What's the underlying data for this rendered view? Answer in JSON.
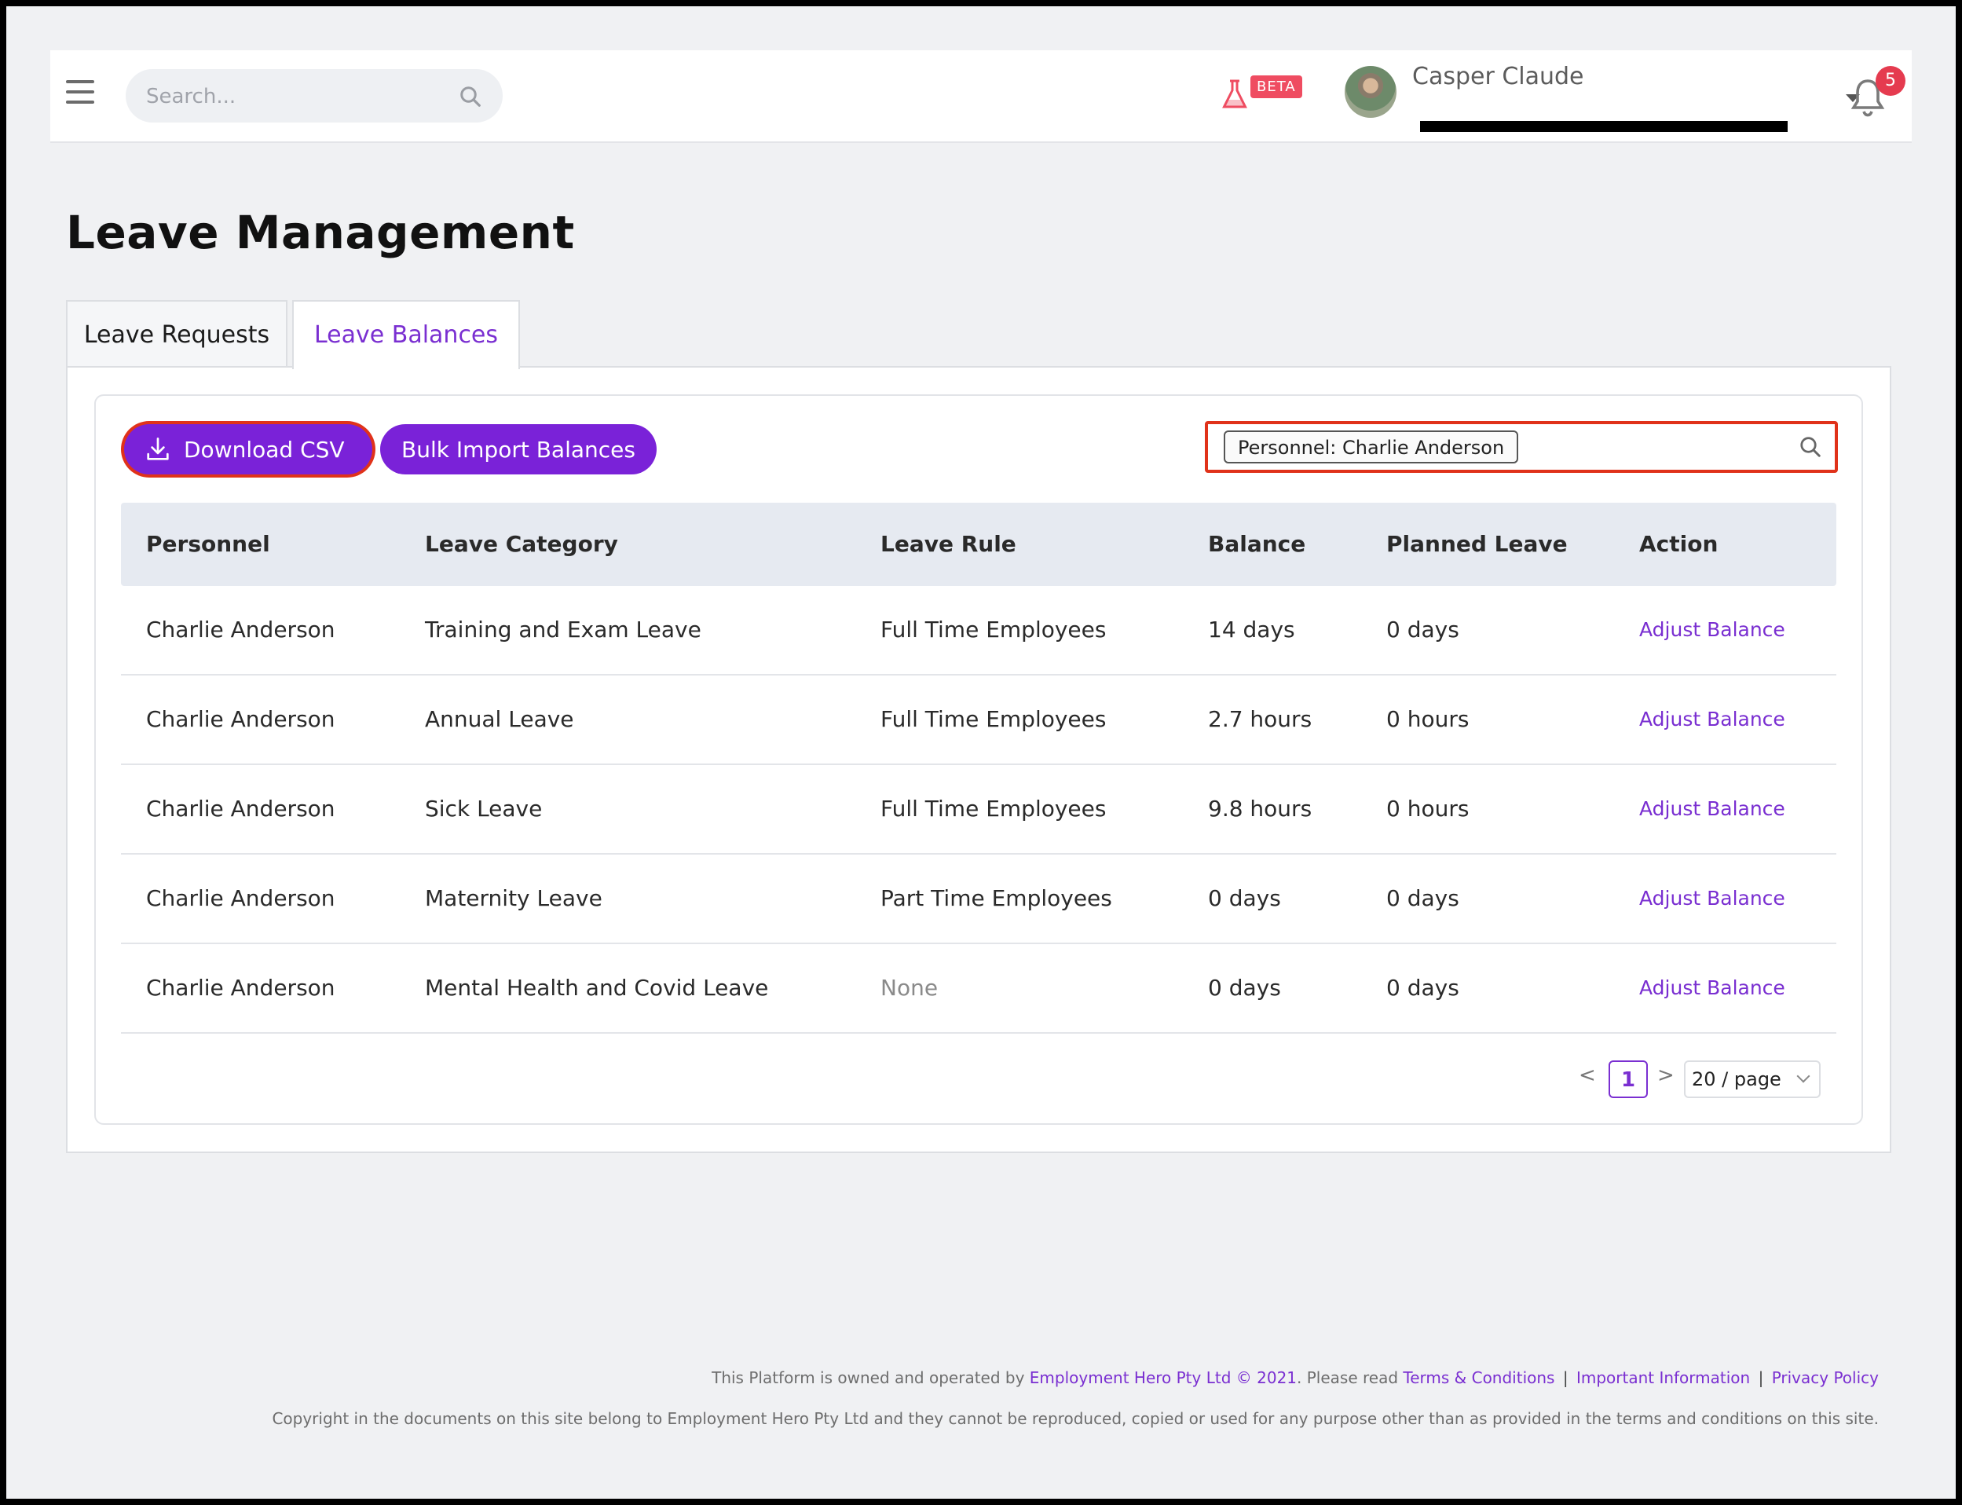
{
  "header": {
    "search_placeholder": "Search...",
    "beta_label": "BETA",
    "user_name": "Casper Claude",
    "notification_count": "5"
  },
  "page": {
    "title": "Leave Management",
    "tabs": [
      {
        "label": "Leave Requests",
        "active": false
      },
      {
        "label": "Leave Balances",
        "active": true
      }
    ]
  },
  "toolbar": {
    "download_label": "Download CSV",
    "bulk_label": "Bulk Import Balances",
    "filter_tag": "Personnel: Charlie Anderson"
  },
  "table": {
    "columns": [
      "Personnel",
      "Leave Category",
      "Leave Rule",
      "Balance",
      "Planned Leave",
      "Action"
    ],
    "rows": [
      {
        "personnel": "Charlie Anderson",
        "category": "Training and Exam Leave",
        "rule": "Full Time Employees",
        "balance": "14 days",
        "planned": "0 days",
        "action": "Adjust Balance"
      },
      {
        "personnel": "Charlie Anderson",
        "category": "Annual Leave",
        "rule": "Full Time Employees",
        "balance": "2.7 hours",
        "planned": "0 hours",
        "action": "Adjust Balance"
      },
      {
        "personnel": "Charlie Anderson",
        "category": "Sick Leave",
        "rule": "Full Time Employees",
        "balance": "9.8 hours",
        "planned": "0 hours",
        "action": "Adjust Balance"
      },
      {
        "personnel": "Charlie Anderson",
        "category": "Maternity Leave",
        "rule": "Part Time Employees",
        "balance": "0 days",
        "planned": "0 days",
        "action": "Adjust Balance"
      },
      {
        "personnel": "Charlie Anderson",
        "category": "Mental Health and Covid Leave",
        "rule": "None",
        "balance": "0 days",
        "planned": "0 days",
        "action": "Adjust Balance"
      }
    ]
  },
  "pagination": {
    "prev": "<",
    "current": "1",
    "next": ">",
    "page_size": "20 / page"
  },
  "footer": {
    "line1_prefix": "This Platform is owned and operated by ",
    "company_link": "Employment Hero Pty Ltd © 2021",
    "line1_mid": ". Please read ",
    "terms_link": "Terms & Conditions",
    "sep": "|",
    "info_link": "Important Information",
    "privacy_link": "Privacy Policy",
    "line2": "Copyright in the documents on this site belong to Employment Hero Pty Ltd and they cannot be reproduced, copied or used for any purpose other than as provided in the terms and conditions on this site."
  },
  "colors": {
    "accent": "#7a22d8",
    "highlight": "#e0321a",
    "badge": "#e53b4f"
  }
}
